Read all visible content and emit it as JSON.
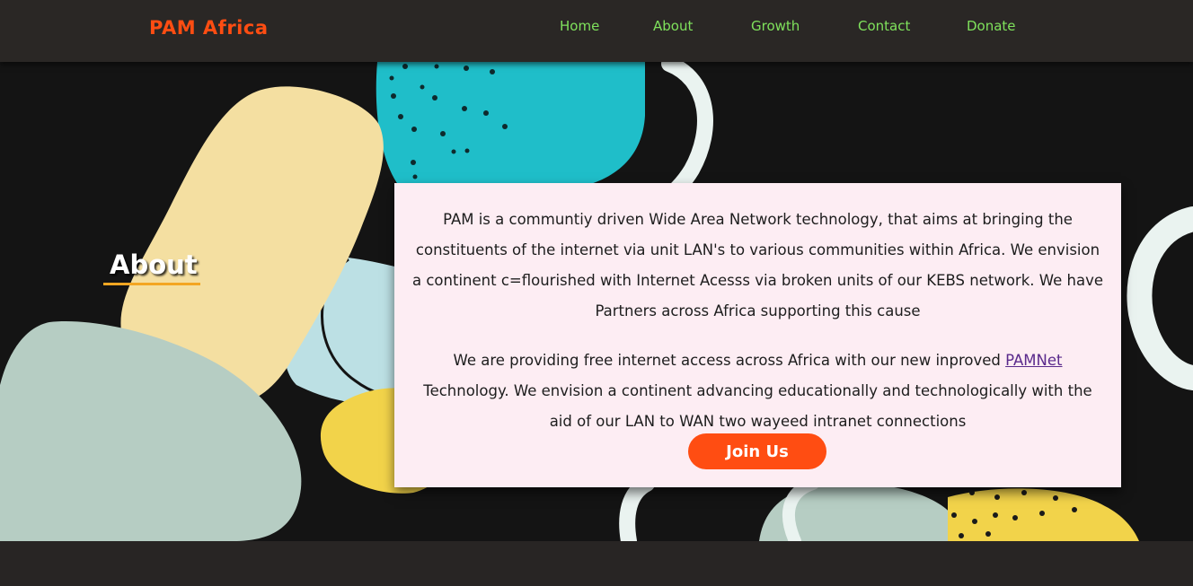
{
  "nav": {
    "brand": "PAM Africa",
    "links": [
      {
        "label": "Home"
      },
      {
        "label": "About"
      },
      {
        "label": "Growth"
      },
      {
        "label": "Contact"
      },
      {
        "label": "Donate"
      }
    ]
  },
  "about": {
    "heading": "About",
    "paragraph1": "PAM is a communtiy driven Wide Area Network technology, that aims at bringing the constituents of the internet via unit LAN's to various communities within Africa. We envision a continent c=flourished with Internet Acesss via broken units of our KEBS network. We have Partners across Africa supporting this cause",
    "paragraph2_before": "We are providing free internet access across Africa with our new inproved ",
    "paragraph2_link": "PAMNet",
    "paragraph2_after": " Technology. We envision a continent advancing educationally and technologically with the aid of our LAN to WAN two wayeed intranet connections",
    "cta": "Join Us"
  },
  "colors": {
    "brand": "#ff4d12",
    "nav_link": "#7fe25c",
    "accent_underline": "#f3a622",
    "card_bg": "#fdedf3",
    "hero_bg": "#141414"
  }
}
